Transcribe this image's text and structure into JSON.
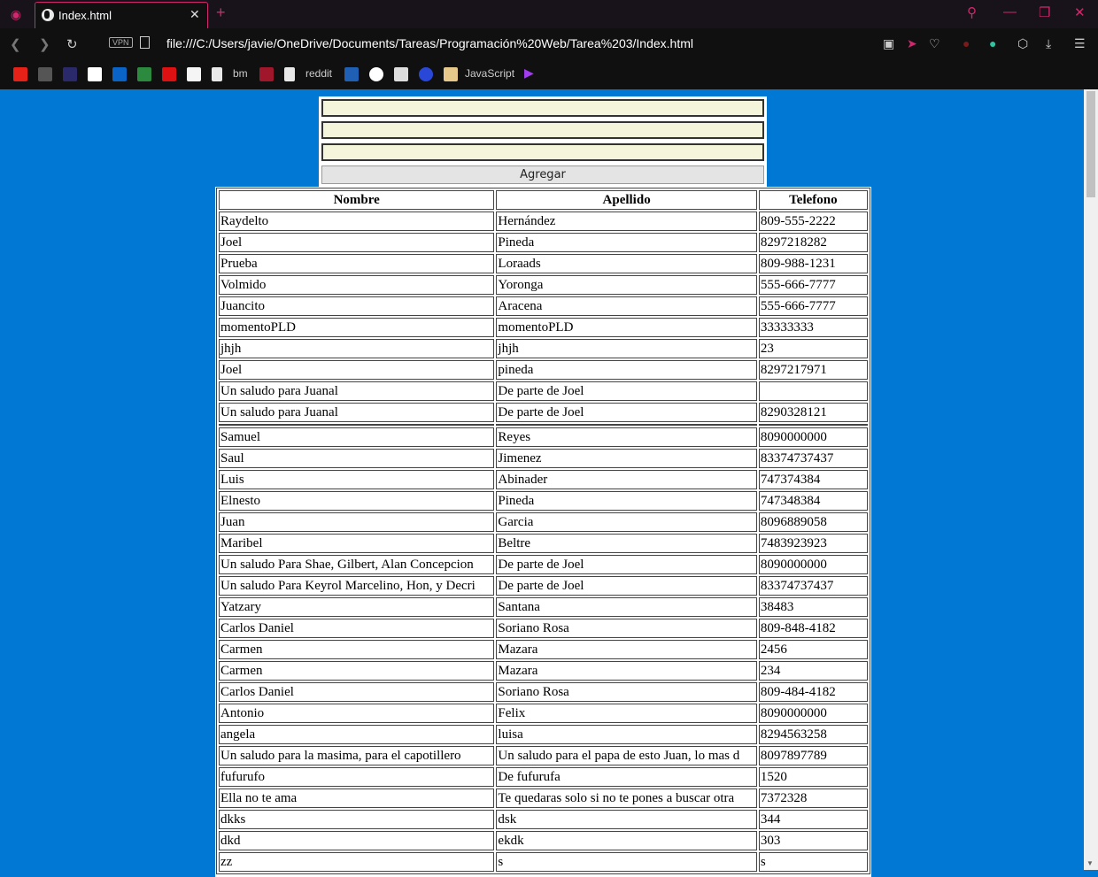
{
  "browser": {
    "tab_title": "Index.html",
    "url": "file:///C:/Users/javie/OneDrive/Documents/Tareas/Programación%20Web/Tarea%203/Index.html",
    "vpn_label": "VPN",
    "bookmarks": {
      "bm_label": "bm",
      "reddit_label": "reddit",
      "javascript_label": "JavaScript"
    }
  },
  "form": {
    "add_button": "Agregar",
    "field1_value": "",
    "field2_value": "",
    "field3_value": ""
  },
  "table": {
    "headers": [
      "Nombre",
      "Apellido",
      "Telefono"
    ],
    "rows": [
      [
        "Raydelto",
        "Hernández",
        "809-555-2222"
      ],
      [
        "Joel",
        "Pineda",
        "8297218282"
      ],
      [
        "Prueba",
        "Loraads",
        "809-988-1231"
      ],
      [
        "Volmido",
        "Yoronga",
        "555-666-7777"
      ],
      [
        "Juancito",
        "Aracena",
        "555-666-7777"
      ],
      [
        "momentoPLD",
        "momentoPLD",
        "33333333"
      ],
      [
        "jhjh",
        "jhjh",
        "23"
      ],
      [
        "Joel",
        "pineda",
        "8297217971"
      ],
      [
        "Un saludo para Juanal",
        "De parte de Joel",
        ""
      ],
      [
        "Un saludo para Juanal",
        "De parte de Joel",
        "8290328121"
      ],
      [
        "",
        "",
        ""
      ],
      [
        "Samuel",
        "Reyes",
        "8090000000"
      ],
      [
        "Saul",
        "Jimenez",
        "83374737437"
      ],
      [
        "Luis",
        "Abinader",
        "747374384"
      ],
      [
        "Elnesto",
        "Pineda",
        "747348384"
      ],
      [
        "Juan",
        "Garcia",
        "8096889058"
      ],
      [
        "Maribel",
        "Beltre",
        "7483923923"
      ],
      [
        "Un saludo Para Shae, Gilbert, Alan Concepcion",
        "De parte de Joel",
        "8090000000"
      ],
      [
        "Un saludo Para Keyrol Marcelino, Hon, y Decri",
        "De parte de Joel",
        "83374737437"
      ],
      [
        "Yatzary",
        "Santana",
        "38483"
      ],
      [
        "Carlos Daniel",
        "Soriano Rosa",
        "809-848-4182"
      ],
      [
        "Carmen",
        "Mazara",
        "2456"
      ],
      [
        "Carmen",
        "Mazara",
        "234"
      ],
      [
        "Carlos Daniel",
        "Soriano Rosa",
        "809-484-4182"
      ],
      [
        "Antonio",
        "Felix",
        "8090000000"
      ],
      [
        "angela",
        "luisa",
        "8294563258"
      ],
      [
        "Un saludo para la masima, para el capotillero",
        "Un saludo para el papa de esto Juan, lo mas d",
        "8097897789"
      ],
      [
        "fufurufo",
        "De fufurufa",
        "1520"
      ],
      [
        "Ella no te ama",
        "Te quedaras solo si no te pones a buscar otra",
        "7372328"
      ],
      [
        "dkks",
        "dsk",
        "344"
      ],
      [
        "dkd",
        "ekdk",
        "303"
      ],
      [
        "zz",
        "s",
        "s"
      ]
    ]
  }
}
